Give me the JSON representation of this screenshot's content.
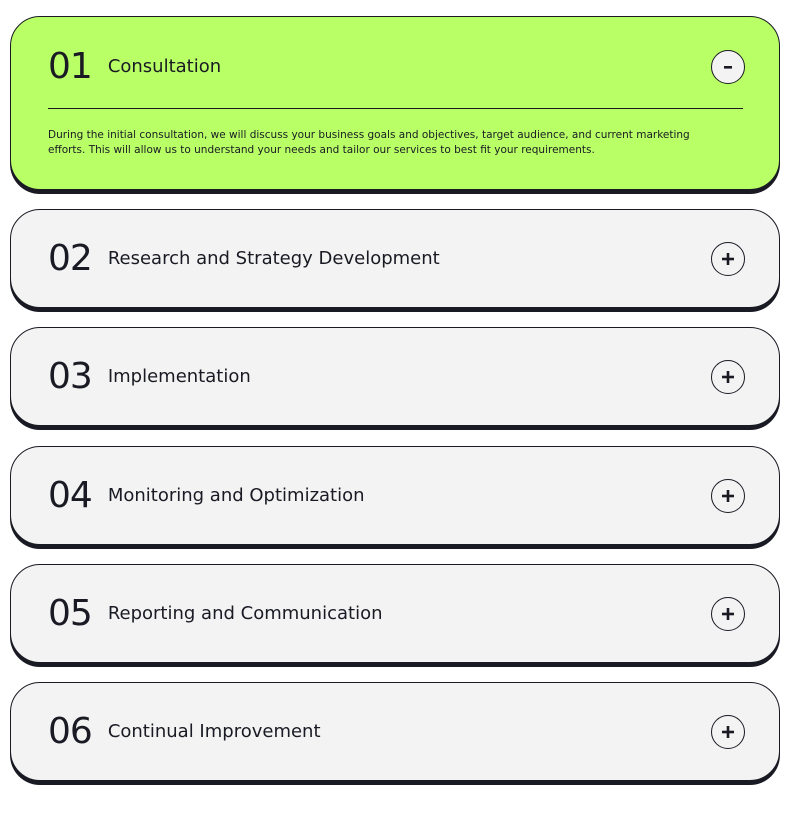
{
  "colors": {
    "open_background": "#b9ff66",
    "closed_background": "#f3f3f3",
    "dark": "#191a23"
  },
  "items": [
    {
      "number": "01",
      "title": "Consultation",
      "expanded": true,
      "toggle_icon": "minus-icon",
      "description": "During the initial consultation, we will discuss your business goals and objectives, target audience, and current marketing efforts. This will allow us to understand your needs and tailor our services to best fit your requirements."
    },
    {
      "number": "02",
      "title": "Research and Strategy Development",
      "expanded": false,
      "toggle_icon": "plus-icon"
    },
    {
      "number": "03",
      "title": "Implementation",
      "expanded": false,
      "toggle_icon": "plus-icon"
    },
    {
      "number": "04",
      "title": "Monitoring and Optimization",
      "expanded": false,
      "toggle_icon": "plus-icon"
    },
    {
      "number": "05",
      "title": "Reporting and Communication",
      "expanded": false,
      "toggle_icon": "plus-icon"
    },
    {
      "number": "06",
      "title": "Continual Improvement",
      "expanded": false,
      "toggle_icon": "plus-icon"
    }
  ]
}
